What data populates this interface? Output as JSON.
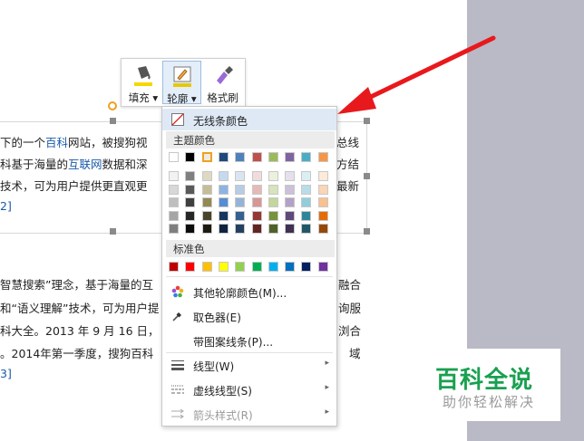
{
  "document": {
    "para1": [
      {
        "pre": "下的一个",
        "link": "百科",
        "post": "网站，被搜狗视"
      },
      {
        "pre": "科基于海量的",
        "link": "互联网",
        "post": "数据和深"
      },
      {
        "pre": "技术，可为用户提供更直观更",
        "link": "",
        "post": ""
      },
      {
        "pre": "",
        "link": "2]",
        "post": ""
      }
    ],
    "para1_right": [
      "总线",
      "方结",
      "最新"
    ],
    "para2": [
      {
        "text": "智慧搜索”理念，基于海量的互"
      },
      {
        "text": "和“语义理解”技术，可为用户提"
      },
      {
        "text": "科大全。2013 年 9 月 16 日，"
      },
      {
        "text": "。2014年第一季度，搜狗百科"
      },
      {
        "text": "3]"
      }
    ],
    "para2_right": [
      "融合",
      "询服",
      "浏合",
      "域"
    ]
  },
  "toolbar": {
    "fill_label": "填充",
    "outline_label": "轮廓",
    "format_label": "格式刷",
    "fill_color": "#f5d800",
    "outline_color": "#e8c800"
  },
  "menu": {
    "no_line": "无线条颜色",
    "theme_header": "主题颜色",
    "theme_top": [
      "#ffffff",
      "#000000",
      "#eeece1",
      "#1f497d",
      "#4f81bd",
      "#c0504d",
      "#9bbb59",
      "#8064a2",
      "#4bacc6",
      "#f79646"
    ],
    "theme_shades": [
      [
        "#f2f2f2",
        "#7f7f7f",
        "#ddd9c3",
        "#c6d9f0",
        "#dbe5f1",
        "#f2dcdb",
        "#ebf1dd",
        "#e5e0ec",
        "#dbeef3",
        "#fdeada"
      ],
      [
        "#d8d8d8",
        "#595959",
        "#c4bd97",
        "#8db3e2",
        "#b8cce4",
        "#e5b9b7",
        "#d7e3bc",
        "#ccc1d9",
        "#b7dde8",
        "#fbd5b5"
      ],
      [
        "#bfbfbf",
        "#3f3f3f",
        "#938953",
        "#548dd4",
        "#95b3d7",
        "#d99694",
        "#c3d69b",
        "#b2a2c7",
        "#92cddc",
        "#fac08f"
      ],
      [
        "#a5a5a5",
        "#262626",
        "#494429",
        "#17365d",
        "#366092",
        "#953734",
        "#76923c",
        "#5f497a",
        "#31859b",
        "#e36c09"
      ],
      [
        "#7f7f7f",
        "#0c0c0c",
        "#1d1b10",
        "#0f243e",
        "#244061",
        "#632423",
        "#4f6128",
        "#3f3151",
        "#205867",
        "#974806"
      ]
    ],
    "std_header": "标准色",
    "std_colors": [
      "#c00000",
      "#ff0000",
      "#ffc000",
      "#ffff00",
      "#92d050",
      "#00b050",
      "#00b0f0",
      "#0070c0",
      "#002060",
      "#7030a0"
    ],
    "more_colors": "其他轮廓颜色(M)...",
    "picker": "取色器(E)",
    "pattern": "带图案线条(P)...",
    "line_type": "线型(W)",
    "dash_type": "虚线线型(S)",
    "arrow_style": "箭头样式(R)"
  },
  "watermark": {
    "title": "百科全说",
    "subtitle": "助你轻松解决"
  },
  "colors": {
    "arrow_red": "#e8191c",
    "brand_green": "#19a050"
  }
}
